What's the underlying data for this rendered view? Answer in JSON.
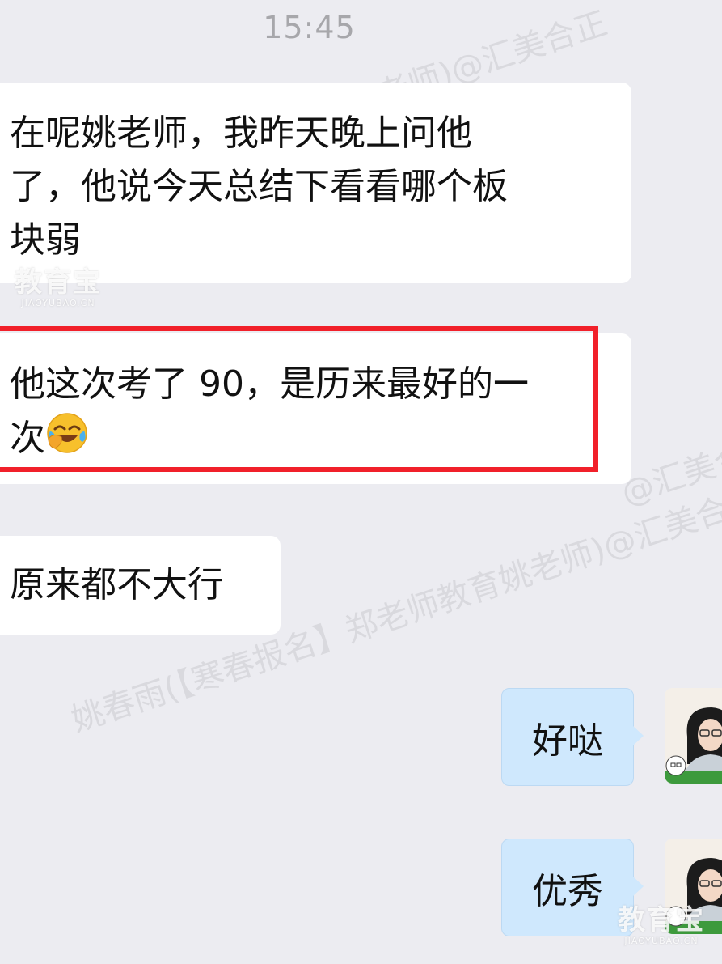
{
  "time": "15:45",
  "watermark": {
    "line1": "姚老师)@汇美合正",
    "line2": "姚春雨(【寒春报名】郑老师教育姚老师)@汇美合",
    "corner": "@汇美合"
  },
  "brand": {
    "name": "教育宝",
    "domain": "JIAOYUBAO.CN"
  },
  "messages": {
    "m1": {
      "line1": "在呢姚老师，我昨天晚上问他",
      "line2": "了，他说今天总结下看看哪个板",
      "line3": "块弱"
    },
    "m2": {
      "line1": "他这次考了 90，是历来最好的一",
      "line2": "次",
      "emoji": "crying-laughing-emoji"
    },
    "m3": {
      "text": "原来都不大行"
    },
    "r1": {
      "text": "好哒"
    },
    "r2": {
      "text": "优秀"
    }
  },
  "colors": {
    "background": "#ececf1",
    "incoming_bubble": "#ffffff",
    "outgoing_bubble": "#cfe8fd",
    "highlight_box": "#f1202a"
  }
}
